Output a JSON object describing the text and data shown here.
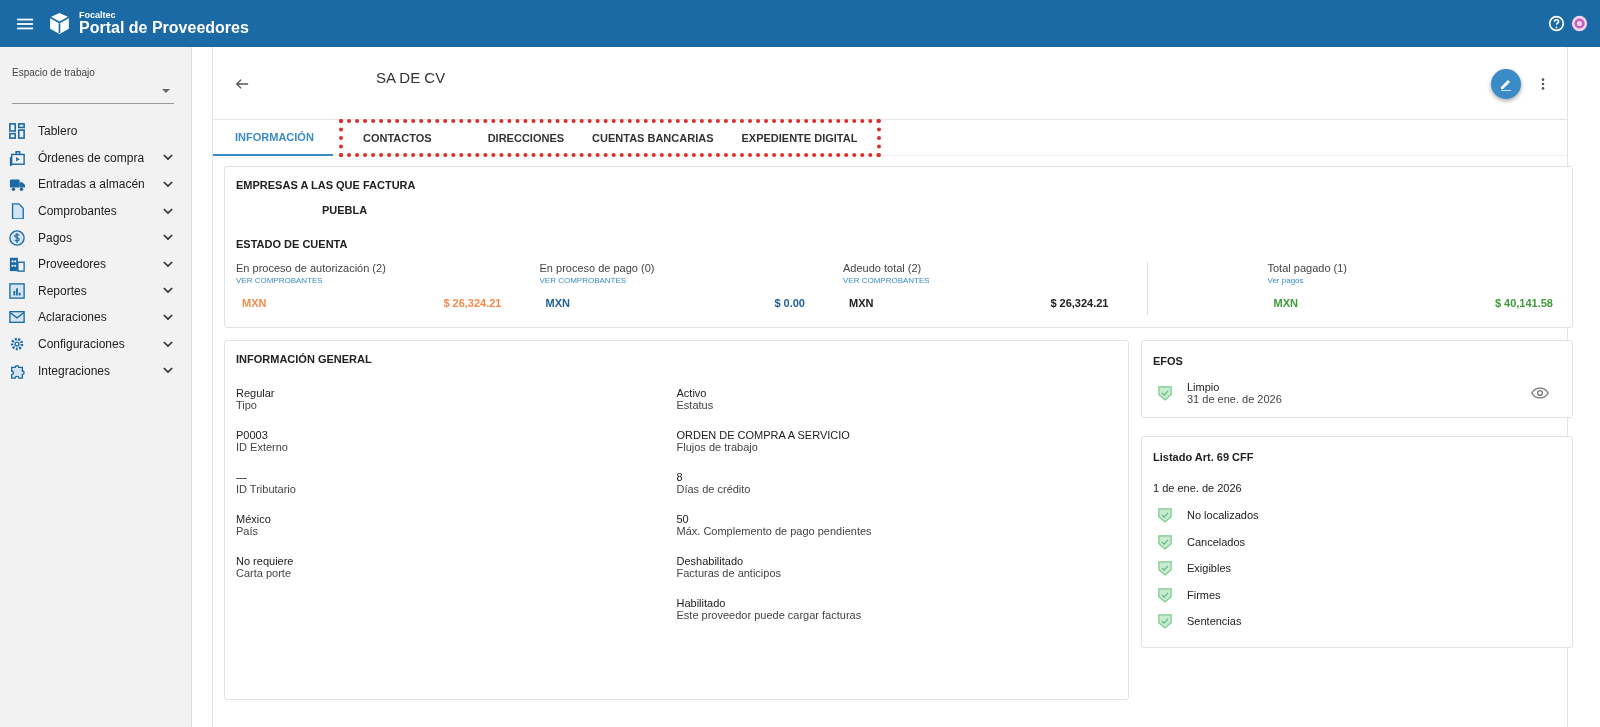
{
  "header": {
    "brand_small": "Focaltec",
    "brand": "Portal de Proveedores"
  },
  "sidebar": {
    "workspace_label": "Espacio de trabajo",
    "items": [
      {
        "label": "Tablero",
        "expandable": false
      },
      {
        "label": "Órdenes de compra",
        "expandable": true
      },
      {
        "label": "Entradas a almacén",
        "expandable": true
      },
      {
        "label": "Comprobantes",
        "expandable": true
      },
      {
        "label": "Pagos",
        "expandable": true
      },
      {
        "label": "Proveedores",
        "expandable": true
      },
      {
        "label": "Reportes",
        "expandable": true
      },
      {
        "label": "Aclaraciones",
        "expandable": true
      },
      {
        "label": "Configuraciones",
        "expandable": true
      },
      {
        "label": "Integraciones",
        "expandable": true
      }
    ]
  },
  "page": {
    "title": "SA DE CV"
  },
  "tabs": [
    {
      "label": "INFORMACIÓN",
      "selected": true,
      "highlighted": false
    },
    {
      "label": "CONTACTOS",
      "selected": false,
      "highlighted": true
    },
    {
      "label": "DIRECCIONES",
      "selected": false,
      "highlighted": true
    },
    {
      "label": "CUENTAS BANCARIAS",
      "selected": false,
      "highlighted": true
    },
    {
      "label": "EXPEDIENTE DIGITAL",
      "selected": false,
      "highlighted": true
    }
  ],
  "companies": {
    "title": "EMPRESAS A LAS QUE FACTURA",
    "items": [
      "PUEBLA"
    ]
  },
  "account": {
    "title": "ESTADO DE CUENTA",
    "columns": [
      {
        "label": "En proceso de autorización (2)",
        "link": "VER COMPROBANTES",
        "currency": "MXN",
        "amount": "$ 26,324.21",
        "color": "#f28a4b"
      },
      {
        "label": "En proceso de pago (0)",
        "link": "VER COMPROBANTES",
        "currency": "MXN",
        "amount": "$ 0.00",
        "color": "#1f5f99"
      },
      {
        "label": "Adeudo total (2)",
        "link": "VER COMPROBANTES",
        "currency": "MXN",
        "amount": "$ 26,324.21",
        "color": "#212121"
      },
      {
        "label": "Total pagado (1)",
        "link": "Ver pagos",
        "currency": "MXN",
        "amount": "$ 40,141.58",
        "color": "#3d9b3d"
      }
    ]
  },
  "general": {
    "title": "INFORMACIÓN GENERAL",
    "left": [
      {
        "value": "Regular",
        "label": "Tipo"
      },
      {
        "value": "P0003",
        "label": "ID Externo"
      },
      {
        "value": "—",
        "label": "ID Tributario"
      },
      {
        "value": "México",
        "label": "País"
      },
      {
        "value": "No requiere",
        "label": "Carta porte"
      }
    ],
    "right": [
      {
        "value": "Activo",
        "label": "Estatus"
      },
      {
        "value": "ORDEN DE COMPRA A SERVICIO",
        "label": "Flujos de trabajo"
      },
      {
        "value": "8",
        "label": "Días de crédito"
      },
      {
        "value": "50",
        "label": "Máx. Complemento de pago pendientes"
      },
      {
        "value": "Deshabilitado",
        "label": "Facturas de anticipos"
      },
      {
        "value": "Habilitado",
        "label": "Este proveedor puede cargar facturas"
      }
    ]
  },
  "efos": {
    "title": "EFOS",
    "status": "Limpio",
    "date": "31 de ene. de 2026"
  },
  "art69": {
    "title": "Listado Art. 69 CFF",
    "date": "1 de ene. de 2026",
    "items": [
      "No localizados",
      "Cancelados",
      "Exigibles",
      "Firmes",
      "Sentencias"
    ]
  }
}
